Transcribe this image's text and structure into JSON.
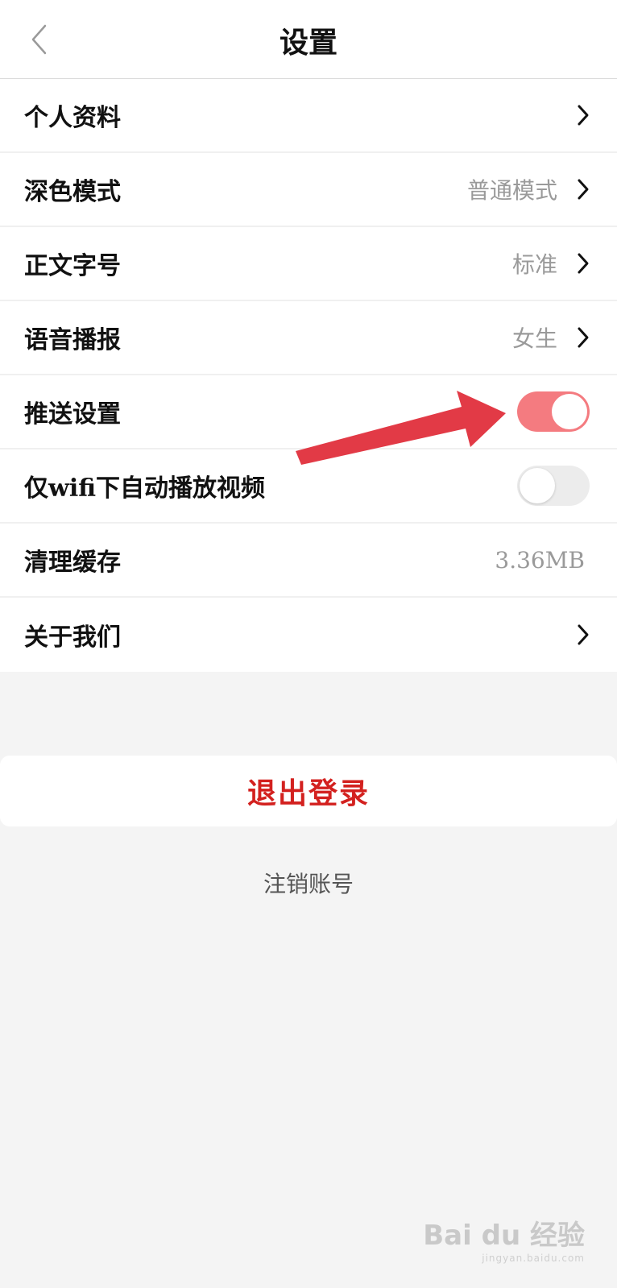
{
  "header": {
    "title": "设置",
    "back_icon": "chevron-left-icon"
  },
  "settings": {
    "profile": {
      "label": "个人资料"
    },
    "dark_mode": {
      "label": "深色模式",
      "value": "普通模式"
    },
    "font_size": {
      "label": "正文字号",
      "value": "标准"
    },
    "voice": {
      "label": "语音播报",
      "value": "女生"
    },
    "push": {
      "label": "推送设置",
      "toggle": "on"
    },
    "wifi_autoplay": {
      "label": "仅wifi下自动播放视频",
      "toggle": "off"
    },
    "cache": {
      "label": "清理缓存",
      "value": "3.36MB"
    },
    "about": {
      "label": "关于我们"
    }
  },
  "actions": {
    "logout_label": "退出登录",
    "cancel_account_label": "注销账号"
  },
  "watermark": {
    "text": "Bai du 经验",
    "subtext": "jingyan.baidu.com"
  },
  "colors": {
    "accent_red": "#d3211f",
    "toggle_on": "#f47b80",
    "annotation_arrow": "#e23a46"
  }
}
